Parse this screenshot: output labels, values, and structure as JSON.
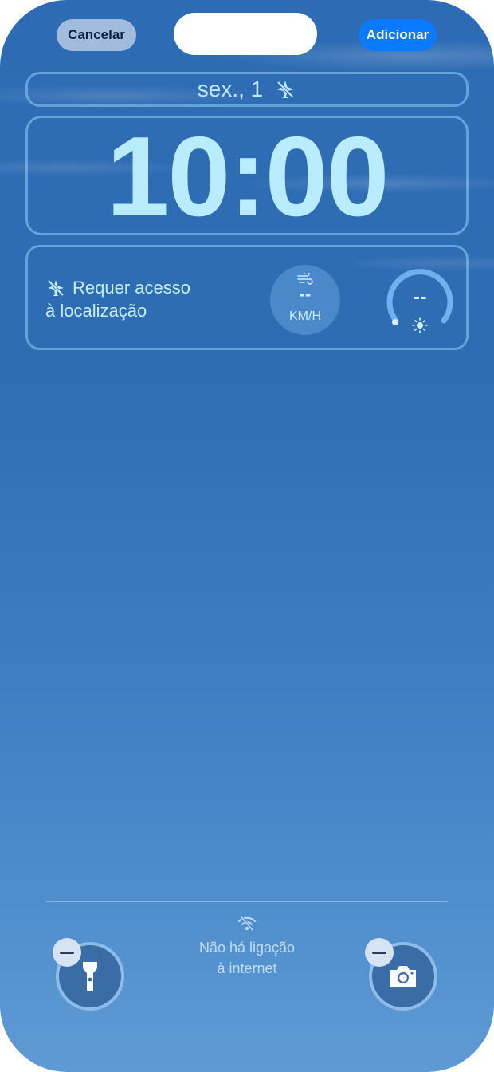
{
  "header": {
    "cancel_label": "Cancelar",
    "add_label": "Adicionar"
  },
  "lockscreen": {
    "date": "sex., 1",
    "time": "10:00"
  },
  "widgets": {
    "location_line1": "Requer acesso",
    "location_line2": "à localização",
    "wind_value": "--",
    "wind_unit": "KM/H",
    "uv_value": "--"
  },
  "footer": {
    "no_internet_line1": "Não há ligação",
    "no_internet_line2": "à internet"
  },
  "icons": {
    "date": "airplane-slash-icon",
    "location": "location-slash-icon",
    "wind": "wind-icon",
    "uv": "sun-icon",
    "wifi": "wifi-slash-icon",
    "left_action": "flashlight-icon",
    "right_action": "camera-icon",
    "remove": "minus-icon"
  },
  "colors": {
    "accent_blue": "#0a7aff",
    "text_cyan": "#bfeaff"
  }
}
